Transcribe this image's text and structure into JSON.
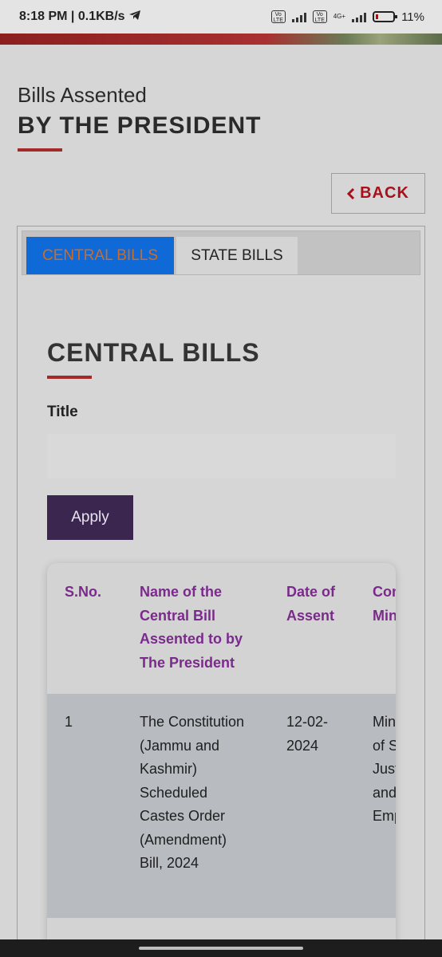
{
  "status_bar": {
    "time": "8:18 PM",
    "speed": "0.1KB/s",
    "battery": "11%",
    "sim_label": "Vo LTE",
    "network": "4G+"
  },
  "heading": {
    "line1": "Bills Assented",
    "line2": "BY THE PRESIDENT"
  },
  "back_button": {
    "label": "BACK"
  },
  "tabs": [
    {
      "label": "CENTRAL BILLS",
      "active": true
    },
    {
      "label": "STATE BILLS",
      "active": false
    }
  ],
  "section": {
    "title": "CENTRAL BILLS",
    "filter_label": "Title",
    "filter_value": "",
    "apply_label": "Apply"
  },
  "table": {
    "headers": [
      "S.No.",
      "Name of the Central Bill Assented to by The President",
      "Date of Assent",
      "Concerned Ministry"
    ],
    "rows": [
      [
        "1",
        "The Constitution (Jammu and Kashmir) Scheduled Castes Order (Amendment) Bill, 2024",
        "12-02-2024",
        "Ministry of Social Justice and Empowerment"
      ]
    ]
  },
  "colors": {
    "accent_red": "#a42a2a",
    "active_tab_bg": "#0f6ad8",
    "header_purple": "#7a2a8a",
    "apply_bg": "#3b2650"
  }
}
